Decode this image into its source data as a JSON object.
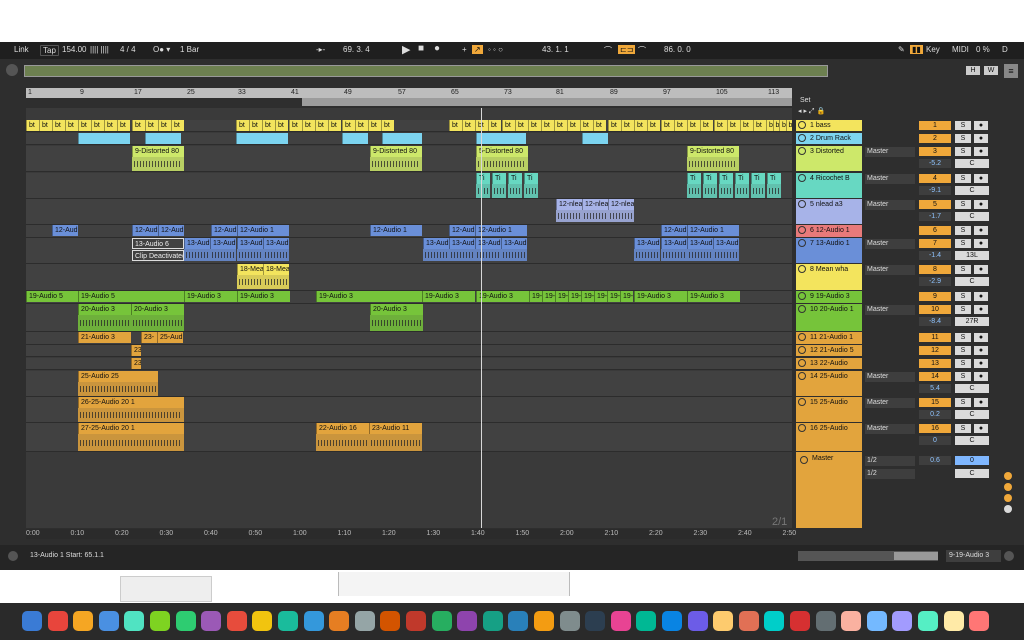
{
  "control_bar": {
    "link": "Link",
    "tap": "Tap",
    "tempo": "154.00",
    "time_sig": "4 / 4",
    "quant": "1 Bar",
    "position": "69.  3.  4",
    "loop_start": "43.  1.  1",
    "loop_len": "86.  0.  0",
    "key": "Key",
    "midi": "MIDI",
    "cpu": "0 %",
    "disk": "D",
    "h": "H",
    "w": "W"
  },
  "bar_ruler": [
    "1",
    "9",
    "17",
    "25",
    "33",
    "41",
    "49",
    "57",
    "65",
    "73",
    "81",
    "89",
    "97",
    "105",
    "113"
  ],
  "time_ruler": [
    "0:00",
    "0:10",
    "0:20",
    "0:30",
    "0:40",
    "0:50",
    "1:00",
    "1:10",
    "1:20",
    "1:30",
    "1:40",
    "1:50",
    "2:00",
    "2:10",
    "2:20",
    "2:30",
    "2:40",
    "2:50"
  ],
  "set_label": "Set",
  "page_counter": "2/1",
  "tracks": [
    {
      "name": "1 bass",
      "color": "#f3e45d",
      "route": "",
      "num": "1",
      "vol": "",
      "rbtn": ""
    },
    {
      "name": "2 Drum Rack",
      "color": "#7cd4f0",
      "route": "",
      "num": "2",
      "vol": "",
      "rbtn": ""
    },
    {
      "name": "3 Distorted",
      "color": "#cde86a",
      "route": "Master",
      "num": "3",
      "vol": "-5.2",
      "rbtn": ""
    },
    {
      "name": "4 Ricochet B",
      "color": "#67d8c2",
      "route": "Master",
      "num": "4",
      "vol": "-9.1",
      "rbtn": ""
    },
    {
      "name": "5 nlead  a3",
      "color": "#a7b3e8",
      "route": "Master",
      "num": "5",
      "vol": "-1.7",
      "rbtn": ""
    },
    {
      "name": "6 12-Audio 1",
      "color": "#e87a7a",
      "route": "",
      "num": "6",
      "vol": "",
      "rbtn": ""
    },
    {
      "name": "7 13-Audio 1",
      "color": "#6a8fd8",
      "route": "Master",
      "num": "7",
      "vol": "-1.4",
      "rbtn": "13L"
    },
    {
      "name": "8 Mean wha",
      "color": "#f3e45d",
      "route": "Master",
      "num": "8",
      "vol": "-2.9",
      "rbtn": ""
    },
    {
      "name": "9 19-Audio 3",
      "color": "#76c43a",
      "route": "",
      "num": "9",
      "vol": "",
      "rbtn": ""
    },
    {
      "name": "10 20-Audio 1",
      "color": "#76c43a",
      "route": "Master",
      "num": "10",
      "vol": "-8.4",
      "rbtn": "27R"
    },
    {
      "name": "11 21-Audio 1",
      "color": "#e2a43d",
      "route": "",
      "num": "11",
      "vol": "",
      "rbtn": ""
    },
    {
      "name": "12 21-Audio 5",
      "color": "#e2a43d",
      "route": "",
      "num": "12",
      "vol": "",
      "rbtn": ""
    },
    {
      "name": "13 22-Audio",
      "color": "#e2a43d",
      "route": "",
      "num": "13",
      "vol": "",
      "rbtn": ""
    },
    {
      "name": "14 25-Audio",
      "color": "#e2a43d",
      "route": "Master",
      "num": "14",
      "vol": "5.4",
      "rbtn": ""
    },
    {
      "name": "15 25-Audio",
      "color": "#e2a43d",
      "route": "Master",
      "num": "15",
      "vol": "0.2",
      "rbtn": ""
    },
    {
      "name": "16 25-Audio",
      "color": "#e2a43d",
      "route": "Master",
      "num": "16",
      "vol": "0",
      "rbtn": ""
    }
  ],
  "master": {
    "name": "Master",
    "sel1": "1/2",
    "sel2": "1/2",
    "vol": "0.6",
    "num": "0"
  },
  "solo_label": "S",
  "center_label": "C",
  "clips": {
    "distorted": "9-Distorted 80",
    "distorted2": "5-Distorted 80",
    "nlead": "12-nlea",
    "audio12": "12-Audio 1",
    "audio12s": "12-Aud",
    "audio13": "13-Audio 6",
    "audio13s": "13-Aud",
    "deactivated": "Clip Deactivated",
    "mean": "18-Mea",
    "a19": "19-Audio 3",
    "a19b": "19-Audio 5",
    "a20": "20-Audio 3",
    "a21": "21-Audio 3",
    "a23": "23-",
    "a25": "25-Aud",
    "a25b": "25-Audio 25",
    "a26": "26-25-Audio 20 1",
    "a27": "27-25-Audio 20 1",
    "a22": "22-Audio 16",
    "a23b": "23-Audio 11",
    "ricochet": "Ti",
    "bass_frag": "bt"
  },
  "status": {
    "left": "13-Audio 1  Start: 65.1.1",
    "right": "9-19-Audio 3"
  }
}
